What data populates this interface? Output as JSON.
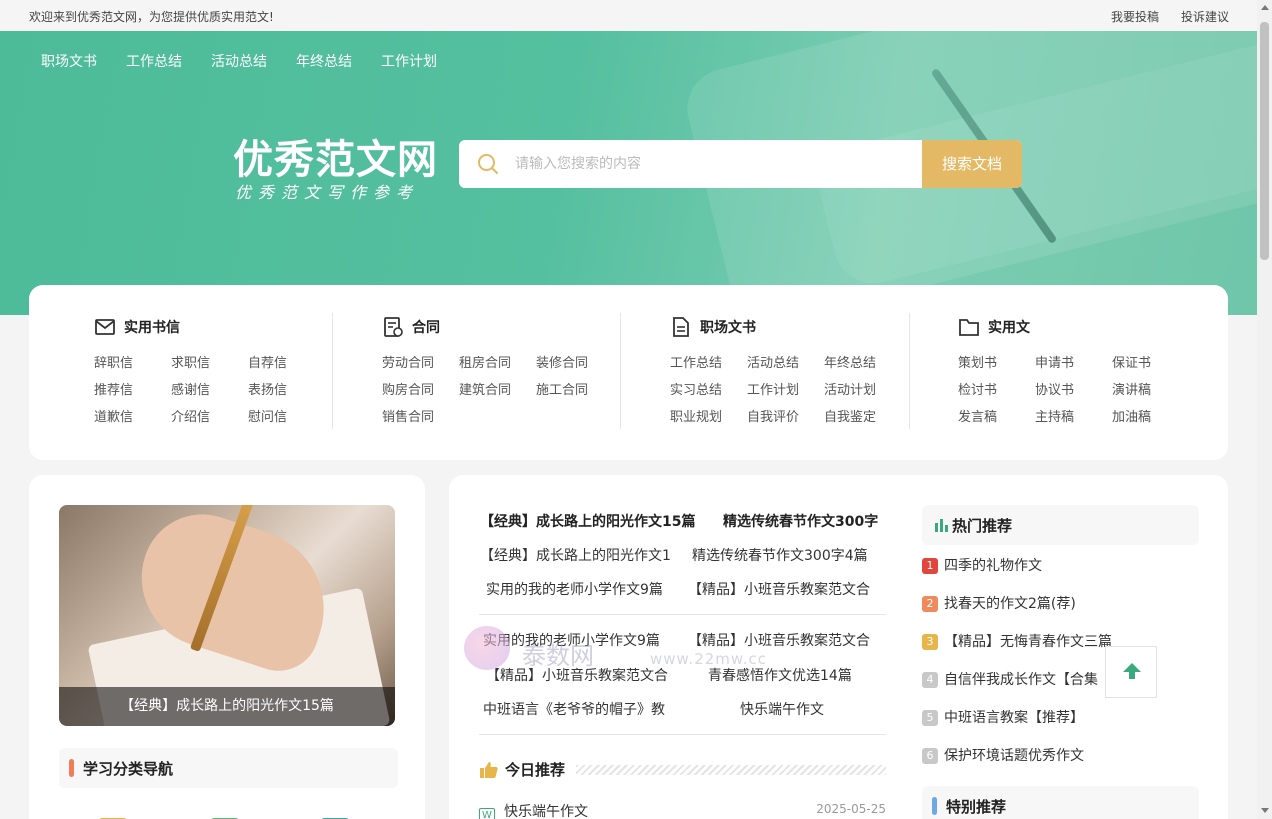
{
  "topbar": {
    "welcome": "欢迎来到优秀范文网，为您提供优质实用范文!",
    "links": [
      "我要投稿",
      "投诉建议"
    ]
  },
  "nav": [
    "职场文书",
    "工作总结",
    "活动总结",
    "年终总结",
    "工作计划"
  ],
  "logo": {
    "main": "优秀范文网",
    "sub": "优秀范文写作参考"
  },
  "search": {
    "placeholder": "请输入您搜索的内容",
    "button": "搜索文档"
  },
  "categories": [
    {
      "title": "实用书信",
      "icon": "mail-icon",
      "items": [
        "辞职信",
        "求职信",
        "自荐信",
        "推荐信",
        "感谢信",
        "表扬信",
        "道歉信",
        "介绍信",
        "慰问信"
      ]
    },
    {
      "title": "合同",
      "icon": "contract-icon",
      "items": [
        "劳动合同",
        "租房合同",
        "装修合同",
        "购房合同",
        "建筑合同",
        "施工合同",
        "销售合同"
      ]
    },
    {
      "title": "职场文书",
      "icon": "document-icon",
      "items": [
        "工作总结",
        "活动总结",
        "年终总结",
        "实习总结",
        "工作计划",
        "活动计划",
        "职业规划",
        "自我评价",
        "自我鉴定"
      ]
    },
    {
      "title": "实用文",
      "icon": "folder-icon",
      "items": [
        "策划书",
        "申请书",
        "保证书",
        "检讨书",
        "协议书",
        "演讲稿",
        "发言稿",
        "主持稿",
        "加油稿"
      ]
    }
  ],
  "left": {
    "photo_caption": "【经典】成长路上的阳光作文15篇",
    "nav_title": "学习分类导航"
  },
  "headlines": {
    "row1": [
      "【经典】成长路上的阳光作文15篇",
      "精选传统春节作文300字"
    ],
    "row2": [
      "【经典】成长路上的阳光作文1",
      "精选传统春节作文300字4篇"
    ],
    "row3": [
      "实用的我的老师小学作文9篇",
      "【精品】小班音乐教案范文合"
    ],
    "row4": [
      "实用的我的老师小学作文9篇",
      "【精品】小班音乐教案范文合"
    ],
    "row5": [
      "【精品】小班音乐教案范文合",
      "青春感悟作文优选14篇"
    ],
    "row6": [
      "中班语言《老爷爷的帽子》教",
      "快乐端午作文"
    ]
  },
  "today": {
    "title": "今日推荐",
    "item": {
      "icon": "W",
      "title": "快乐端午作文",
      "date": "2025-05-25"
    }
  },
  "hot": {
    "title": "热门推荐",
    "items": [
      {
        "n": "1",
        "t": "四季的礼物作文"
      },
      {
        "n": "2",
        "t": "找春天的作文2篇(荐)"
      },
      {
        "n": "3",
        "t": "【精品】无悔青春作文三篇"
      },
      {
        "n": "4",
        "t": "自信伴我成长作文【合集"
      },
      {
        "n": "5",
        "t": "中班语言教案【推荐】"
      },
      {
        "n": "6",
        "t": "保护环境话题优秀作文"
      }
    ],
    "colors": [
      "#e0463c",
      "#f08a5d",
      "#e8b54a",
      "#c8c8c8",
      "#c8c8c8",
      "#c8c8c8"
    ]
  },
  "special": {
    "title": "特别推荐"
  },
  "watermark": {
    "text": "泰数网",
    "url": "www.22mw.cc"
  },
  "theme": {
    "hero": "#55c09f",
    "accent": "#e3b965",
    "green": "#3aaa7d"
  }
}
